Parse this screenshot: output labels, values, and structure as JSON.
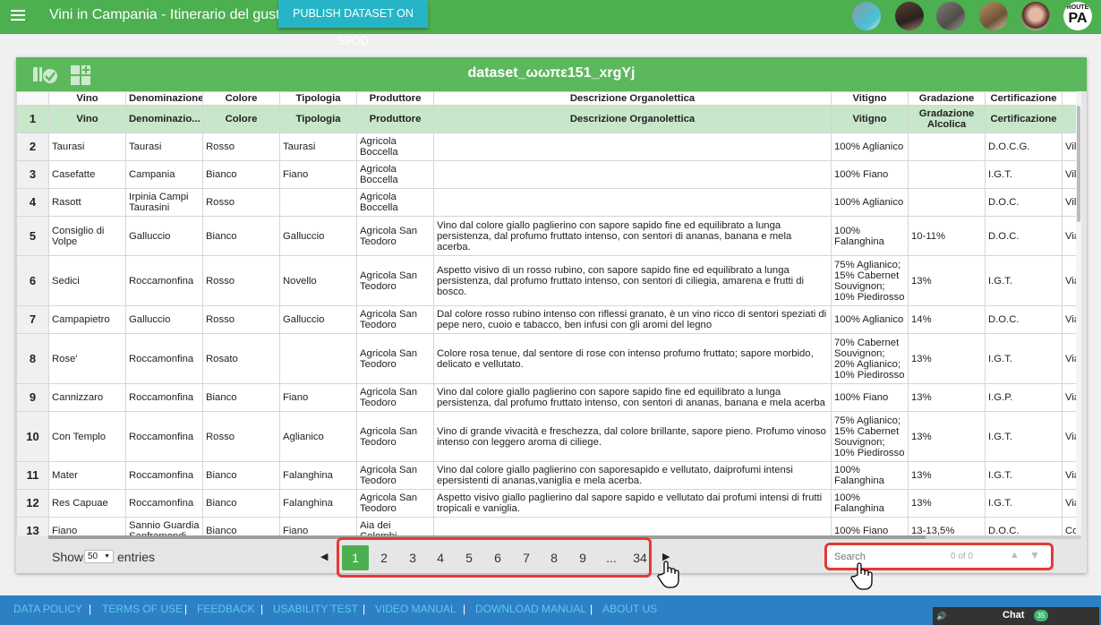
{
  "topbar": {
    "title": "Vini in Campania - Itinerario del gusto",
    "publish_label": "PUBLISH DATASET ON SPOD",
    "logo_small": "ROUTE",
    "logo_big": "PA"
  },
  "panel": {
    "dataset_title": "dataset_ωωπε151_xrgYj"
  },
  "table": {
    "header_top": [
      "Vino",
      "Denominazione",
      "Colore",
      "Tipologia",
      "Produttore",
      "Descrizione Organolettica",
      "Vitigno",
      "Gradazione",
      "Certificazione",
      "Indi"
    ],
    "header_row_num": "1",
    "header_row": [
      "Vino",
      "Denominazio...",
      "Colore",
      "Tipologia",
      "Produttore",
      "Descrizione Organolettica",
      "Vitigno",
      "Gradazione Alcolica",
      "Certificazione",
      "In"
    ],
    "rows": [
      {
        "n": "2",
        "cells": [
          "Taurasi",
          "Taurasi",
          "Rosso",
          "Taurasi",
          "Agricola Boccella",
          "",
          "100% Aglianico",
          "",
          "D.O.C.G.",
          "Villag Eust"
        ]
      },
      {
        "n": "3",
        "cells": [
          "Casefatte",
          "Campania",
          "Bianco",
          "Fiano",
          "Agricola Boccella",
          "",
          "100% Fiano",
          "",
          "I.G.T.",
          "Villag Eust"
        ]
      },
      {
        "n": "4",
        "cells": [
          "Rasott",
          "Irpinia Campi Taurasini",
          "Rosso",
          "",
          "Agricola Boccella",
          "",
          "100% Aglianico",
          "",
          "D.O.C.",
          "Villag Eust"
        ]
      },
      {
        "n": "5",
        "cells": [
          "Consiglio di Volpe",
          "Galluccio",
          "Bianco",
          "Galluccio",
          "Agricola San Teodoro",
          "Vino dal colore giallo paglierino con sapore sapido fine ed equilibrato a lunga persistenza, dal profumo fruttato intenso, con sentori di ananas, banana e mela acerba.",
          "100% Falanghina",
          "10-11%",
          "D.O.C.",
          "Via F Loc."
        ]
      },
      {
        "n": "6",
        "cells": [
          "Sedici",
          "Roccamonfina",
          "Rosso",
          "Novello",
          "Agricola San Teodoro",
          "Aspetto visivo di un rosso rubino, con sapore sapido fine ed equilibrato a lunga persistenza, dal profumo fruttato intenso, con sentori di ciliegia, amarena e frutti di bosco.",
          "75% Aglianico; 15% Cabernet Souvignon; 10% Piedirosso",
          "13%",
          "I.G.T.",
          "Via F Loc."
        ]
      },
      {
        "n": "7",
        "cells": [
          "Campapietro",
          "Galluccio",
          "Rosso",
          "Galluccio",
          "Agricola San Teodoro",
          "Dal colore rosso rubino intenso con riflessi granato, è un vino ricco di sentori speziati di pepe nero, cuoio e tabacco, ben infusi con gli aromi del legno",
          "100% Aglianico",
          "14%",
          "D.O.C.",
          "Via F Loc."
        ]
      },
      {
        "n": "8",
        "cells": [
          "Rose'",
          "Roccamonfina",
          "Rosato",
          "",
          "Agricola San Teodoro",
          "Colore rosa tenue, dal sentore di rose con intenso profumo fruttato; sapore morbido, delicato e vellutato.",
          "70% Cabernet Souvignon; 20% Aglianico; 10% Piedirosso",
          "13%",
          "I.G.T.",
          "Via F Loc."
        ]
      },
      {
        "n": "9",
        "cells": [
          "Cannizzaro",
          "Roccamonfina",
          "Bianco",
          "Fiano",
          "Agricola San Teodoro",
          "Vino dal colore giallo paglierino con sapore sapido fine ed equilibrato a lunga persistenza, dal profumo fruttato intenso, con sentori di ananas, banana e mela acerba",
          "100% Fiano",
          "13%",
          "I.G.P.",
          "Via F Loc."
        ]
      },
      {
        "n": "10",
        "cells": [
          "Con Templo",
          "Roccamonfina",
          "Rosso",
          "Aglianico",
          "Agricola San Teodoro",
          "Vino di grande vivacità e freschezza, dal colore brillante, sapore pieno. Profumo vinoso intenso con leggero aroma di ciliege.",
          "75% Aglianico; 15% Cabernet Souvignon; 10% Piedirosso",
          "13%",
          "I.G.T.",
          "Via F Loc."
        ]
      },
      {
        "n": "11",
        "cells": [
          "Mater",
          "Roccamonfina",
          "Bianco",
          "Falanghina",
          "Agricola San Teodoro",
          "Vino dal colore giallo paglierino con saporesapido e vellutato, daiprofumi intensi epersistenti di ananas,vaniglia e mela acerba.",
          "100% Falanghina",
          "13%",
          "I.G.T.",
          "Via F Loc."
        ]
      },
      {
        "n": "12",
        "cells": [
          "Res Capuae",
          "Roccamonfina",
          "Bianco",
          "Falanghina",
          "Agricola San Teodoro",
          "Aspetto visivo giallo paglierino dal sapore sapido e vellutato dai profumi intensi di frutti tropicali e vaniglia.",
          "100% Falanghina",
          "13%",
          "I.G.T.",
          "Via F Loc."
        ]
      },
      {
        "n": "13",
        "cells": [
          "Fiano",
          "Sannio Guardia Sanframondi",
          "Bianco",
          "Fiano",
          "Aia dei Colombi",
          "",
          "100% Fiano",
          "13-13,5%",
          "D.O.C.",
          "Cont Loc."
        ]
      }
    ]
  },
  "controls": {
    "show_label": "Show",
    "page_size": "50",
    "entries_label": "entries",
    "prev": "◀",
    "next": "▶",
    "pages": [
      "1",
      "2",
      "3",
      "4",
      "5",
      "6",
      "7",
      "8",
      "9",
      "...",
      "34"
    ],
    "search_placeholder": "Search",
    "search_count": "0 of 0",
    "search_up": "▲",
    "search_down": "▼"
  },
  "footer": {
    "links": [
      "DATA POLICY",
      "TERMS OF USE",
      "FEEDBACK",
      "USABILITY TEST",
      "VIDEO MANUAL",
      "DOWNLOAD MANUAL",
      "ABOUT US"
    ],
    "separator": "|",
    "chat_label": "Chat",
    "chat_count": "35",
    "chat_icon": "🔊"
  },
  "colors": {
    "header_green": "#4caf50",
    "publish_teal": "#26b5c6",
    "highlight_red": "#e53935",
    "footer_blue": "#2e80c4"
  }
}
